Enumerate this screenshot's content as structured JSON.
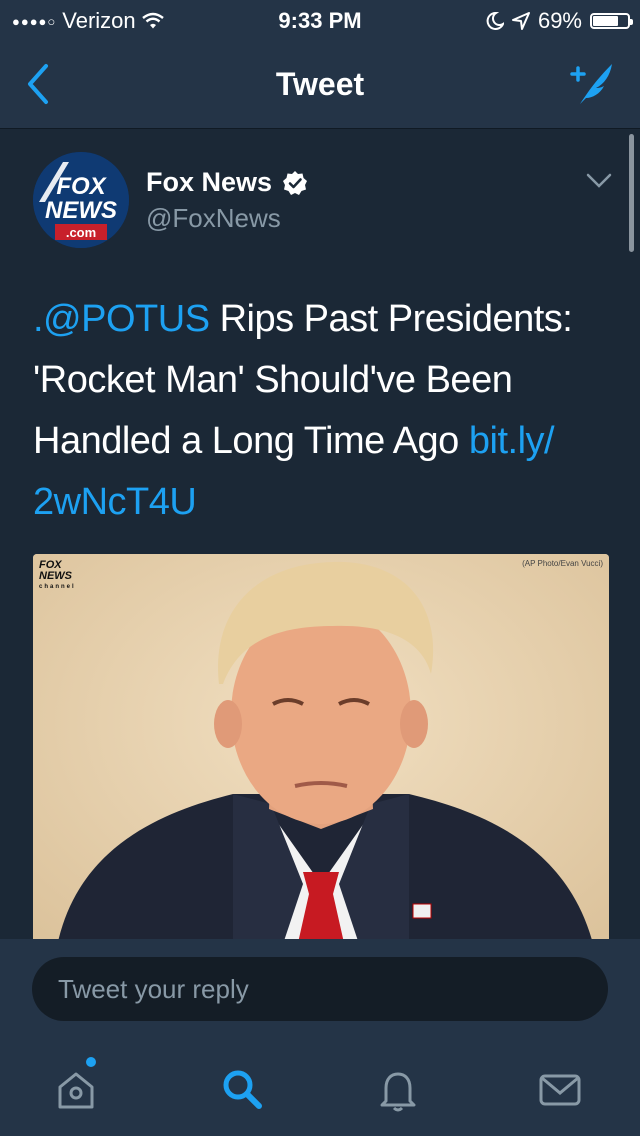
{
  "status_bar": {
    "carrier": "Verizon",
    "time": "9:33 PM",
    "battery_percent": "69%",
    "battery_level": 0.69,
    "icons": [
      "signal-dots-icon",
      "wifi-icon",
      "moon-icon",
      "location-arrow-icon",
      "battery-icon"
    ]
  },
  "nav": {
    "title": "Tweet",
    "back_icon": "back-chevron-icon",
    "compose_icon": "compose-tweet-icon"
  },
  "tweet": {
    "author_name": "Fox News",
    "author_handle": "@FoxNews",
    "verified": true,
    "text_parts": {
      "mention": ".@POTUS",
      "body": " Rips Past Presidents: 'Rocket Man' Should've Been Handled a Long Time Ago ",
      "link": "bit.ly/​2wNcT4U"
    },
    "avatar_text": {
      "line1": "FOX",
      "line2": "NEWS",
      "line3": ".com"
    },
    "media": {
      "logo_line1": "FOX",
      "logo_line2": "NEWS",
      "logo_line3": "channel",
      "credit": "(AP Photo/Evan Vucci)"
    }
  },
  "reply": {
    "placeholder": "Tweet your reply"
  },
  "tabs": [
    {
      "icon": "home-icon",
      "has_notification": true
    },
    {
      "icon": "search-icon",
      "active": true
    },
    {
      "icon": "bell-icon"
    },
    {
      "icon": "mail-icon"
    }
  ],
  "colors": {
    "accent": "#1da1f2",
    "background": "#1b2836",
    "bar": "#243447",
    "secondary_text": "#8899a6"
  }
}
